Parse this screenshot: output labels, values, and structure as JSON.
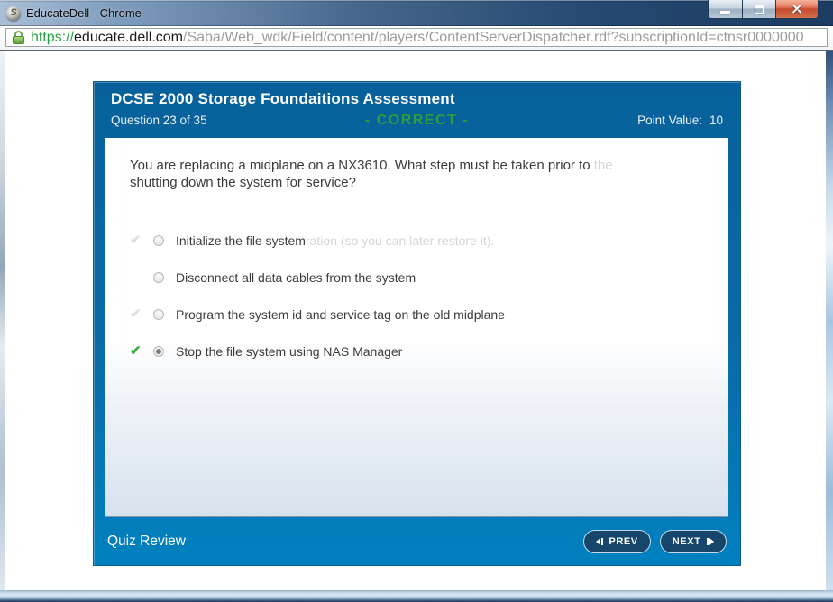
{
  "window": {
    "title": "EducateDell - Chrome",
    "favicon_letter": "S"
  },
  "url": {
    "scheme": "https://",
    "domain": "educate.dell.com",
    "path": "/Saba/Web_wdk/Field/content/players/ContentServerDispatcher.rdf?subscriptionId=ctnsr0000000"
  },
  "quiz": {
    "title": "DCSE 2000 Storage Foundaitions Assessment",
    "progress": "Question 23 of 35",
    "status": "- CORRECT -",
    "point_value_label": "Point Value:",
    "point_value": "10",
    "question_line1": "You are replacing a midplane on a NX3610. What step must be taken prior to",
    "question_ghost_tail": "the",
    "question_line2": "shutting down the system for service?",
    "options": [
      {
        "label": "Initialize the file system",
        "ghost_tail": "ration (so you can later restore it).",
        "check_glyph": "✔",
        "check_state": "ghost",
        "selected": false
      },
      {
        "label": "Disconnect all data cables from the system",
        "check_glyph": "",
        "check_state": "none",
        "selected": false
      },
      {
        "label": "Program the system id and service tag on the old midplane",
        "check_glyph": "✔",
        "check_state": "ghost",
        "selected": false
      },
      {
        "label": "Stop the file system using NAS Manager",
        "check_glyph": "✔",
        "check_state": "correct",
        "selected": true
      }
    ]
  },
  "footer": {
    "quiz_review": "Quiz Review",
    "prev": "PREV",
    "next": "NEXT"
  },
  "colors": {
    "header_blue": "#07609a",
    "footer_blue": "#0081bf",
    "correct_green": "#2f9b3c",
    "check_green": "#3fa73f",
    "url_green": "#2aa143",
    "button_navy": "#16466b"
  }
}
